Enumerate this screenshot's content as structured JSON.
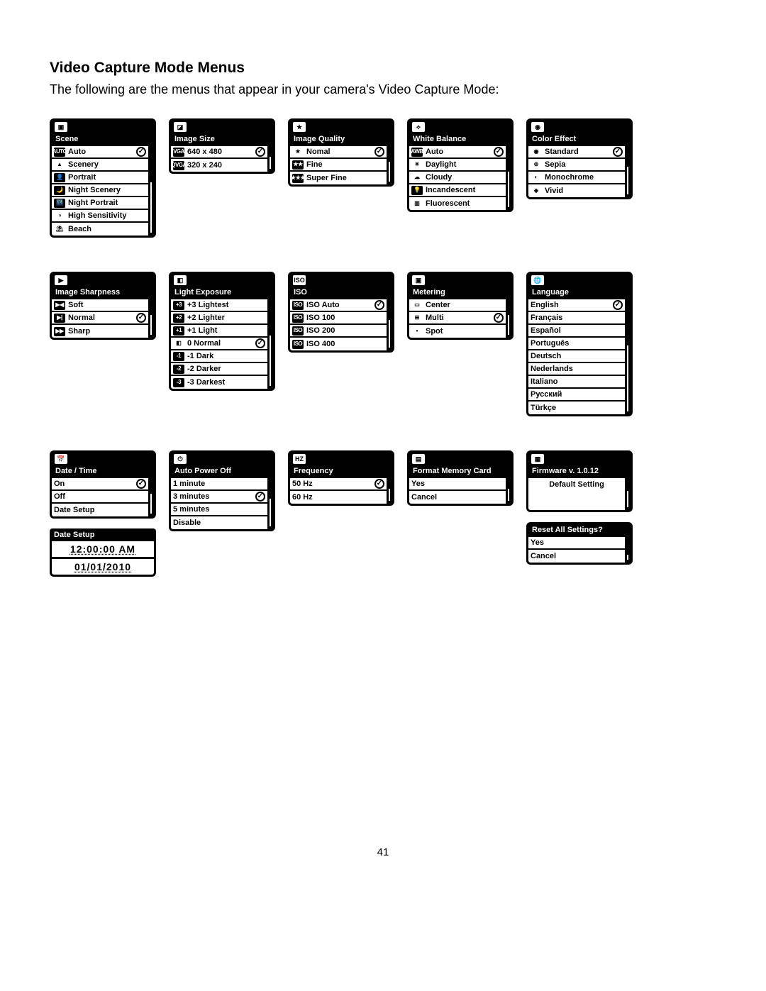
{
  "page": {
    "title": "Video Capture Mode Menus",
    "intro": "The following are the menus that appear in your camera's Video Capture Mode:",
    "number": "41"
  },
  "menus": {
    "scene": {
      "title": "Scene",
      "sel": 0,
      "items": [
        {
          "icon": "AUTO",
          "l": "Auto"
        },
        {
          "icon": "▲",
          "l": "Scenery"
        },
        {
          "icon": "👤",
          "l": "Portrait"
        },
        {
          "icon": "🌙",
          "l": "Night Scenery"
        },
        {
          "icon": "🌃",
          "l": "Night Portrait"
        },
        {
          "icon": "◑",
          "l": "High Sensitivity"
        },
        {
          "icon": "⛱",
          "l": "Beach"
        }
      ]
    },
    "image_size": {
      "title": "Image Size",
      "sel": 0,
      "items": [
        {
          "icon": "VGA",
          "l": "640 x 480"
        },
        {
          "icon": "QVGA",
          "l": "320 x 240"
        }
      ]
    },
    "image_quality": {
      "title": "Image Quality",
      "sel": 0,
      "items": [
        {
          "icon": "★",
          "l": "Nomal"
        },
        {
          "icon": "★★",
          "l": "Fine"
        },
        {
          "icon": "★★★",
          "l": "Super Fine"
        }
      ]
    },
    "white_balance": {
      "title": "White Balance",
      "sel": 0,
      "items": [
        {
          "icon": "AWB",
          "l": "Auto"
        },
        {
          "icon": "☀",
          "l": "Daylight"
        },
        {
          "icon": "☁",
          "l": "Cloudy"
        },
        {
          "icon": "💡",
          "l": "Incandescent"
        },
        {
          "icon": "▥",
          "l": "Fluorescent"
        }
      ]
    },
    "color_effect": {
      "title": "Color Effect",
      "sel": 0,
      "items": [
        {
          "icon": "◉",
          "l": "Standard"
        },
        {
          "icon": "⊚",
          "l": "Sepia"
        },
        {
          "icon": "◐",
          "l": "Monochrome"
        },
        {
          "icon": "◈",
          "l": "Vivid"
        }
      ]
    },
    "sharpness": {
      "title": "Image Sharpness",
      "sel": 1,
      "items": [
        {
          "icon": "▶◀",
          "l": "Soft"
        },
        {
          "icon": "▶|",
          "l": "Normal"
        },
        {
          "icon": "▶▶",
          "l": "Sharp"
        }
      ]
    },
    "exposure": {
      "title": "Light Exposure",
      "sel": 3,
      "items": [
        {
          "icon": "+3",
          "l": "+3 Lightest"
        },
        {
          "icon": "+2",
          "l": "+2 Lighter"
        },
        {
          "icon": "+1",
          "l": "+1 Light"
        },
        {
          "icon": "◧",
          "l": "0 Normal"
        },
        {
          "icon": "-1",
          "l": "-1 Dark"
        },
        {
          "icon": "-2",
          "l": "-2 Darker"
        },
        {
          "icon": "-3",
          "l": "-3 Darkest"
        }
      ]
    },
    "iso": {
      "title": "ISO",
      "sel": 0,
      "items": [
        {
          "icon": "ISO",
          "l": "ISO Auto"
        },
        {
          "icon": "ISO",
          "l": "ISO 100"
        },
        {
          "icon": "ISO",
          "l": "ISO 200"
        },
        {
          "icon": "ISO",
          "l": "ISO 400"
        }
      ]
    },
    "metering": {
      "title": "Metering",
      "sel": 1,
      "items": [
        {
          "icon": "▭",
          "l": "Center"
        },
        {
          "icon": "⊞",
          "l": "Multi"
        },
        {
          "icon": "•",
          "l": "Spot"
        }
      ]
    },
    "language": {
      "title": "Language",
      "sel": 0,
      "items": [
        {
          "icon": "",
          "l": "English"
        },
        {
          "icon": "",
          "l": "Français"
        },
        {
          "icon": "",
          "l": "Español"
        },
        {
          "icon": "",
          "l": "Português"
        },
        {
          "icon": "",
          "l": "Deutsch"
        },
        {
          "icon": "",
          "l": "Nederlands"
        },
        {
          "icon": "",
          "l": "Italiano"
        },
        {
          "icon": "",
          "l": "Русский"
        },
        {
          "icon": "",
          "l": "Türkçe"
        }
      ]
    },
    "date_time": {
      "title": "Date / Time",
      "sel": 0,
      "items": [
        {
          "icon": "",
          "l": "On"
        },
        {
          "icon": "",
          "l": "Off"
        },
        {
          "icon": "",
          "l": "Date Setup"
        }
      ]
    },
    "date_setup": {
      "title": "Date Setup",
      "time": "12:00:00 AM",
      "date": "01/01/2010"
    },
    "power_off": {
      "title": "Auto Power Off",
      "sel": 1,
      "items": [
        {
          "icon": "",
          "l": "1 minute"
        },
        {
          "icon": "",
          "l": "3 minutes"
        },
        {
          "icon": "",
          "l": "5 minutes"
        },
        {
          "icon": "",
          "l": "Disable"
        }
      ]
    },
    "frequency": {
      "title": "Frequency",
      "sel": 0,
      "items": [
        {
          "icon": "",
          "l": "50 Hz"
        },
        {
          "icon": "",
          "l": "60 Hz"
        }
      ]
    },
    "format": {
      "title": "Format Memory Card",
      "sel": -1,
      "items": [
        {
          "icon": "",
          "l": "Yes"
        },
        {
          "icon": "",
          "l": "Cancel"
        }
      ]
    },
    "firmware": {
      "title": "Firmware v. 1.0.12",
      "sel": -1,
      "items": [
        {
          "icon": "",
          "l": "Default Setting"
        }
      ]
    },
    "reset": {
      "title": "Reset All Settings?",
      "sel": -1,
      "items": [
        {
          "icon": "",
          "l": "Yes"
        },
        {
          "icon": "",
          "l": "Cancel"
        }
      ]
    }
  }
}
